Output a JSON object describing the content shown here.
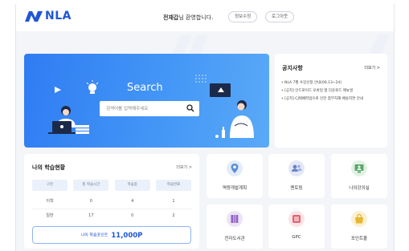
{
  "header": {
    "logo_text": "NLA",
    "welcome_name": "전재갑",
    "welcome_suffix": "님 환영합니다.",
    "buttons": {
      "profile_edit": "정보수정",
      "logout": "로그아웃"
    }
  },
  "banner": {
    "title": "Search",
    "search_placeholder": "검색어를 입력해주세요"
  },
  "notice": {
    "title": "공지사항",
    "more": "더보기 >",
    "items": [
      "• NLA 7월 수강신청 안내(06.13~24)",
      "• [공지] 안드로이드 모바일 앱 다운로드 매뉴얼",
      "• [공지] CJ택배파업으로 인한 참부자재 배송지연 안내"
    ]
  },
  "study": {
    "title": "나의 학습현황",
    "more": "더보기 >",
    "headers": [
      "구분",
      "총 학습시간",
      "학습중",
      "학습완료"
    ],
    "rows": [
      [
        "이학",
        "0",
        "4",
        "1"
      ],
      [
        "일반",
        "17",
        "0",
        "2"
      ]
    ],
    "total_label": "나의 학습포인트",
    "total_value": "11,000P"
  },
  "tiles": [
    {
      "label": "역량개발계획",
      "icon": "location-pin-icon",
      "color": "#5b8fd6",
      "bg": "#e3ecf8"
    },
    {
      "label": "멘토링",
      "icon": "users-icon",
      "color": "#6c83c9",
      "bg": "#e4e8f6"
    },
    {
      "label": "나의강의실",
      "icon": "classroom-icon",
      "color": "#5aa86a",
      "bg": "#e2f1e4"
    },
    {
      "label": "전자도서관",
      "icon": "books-icon",
      "color": "#8f63c2",
      "bg": "#ece3f6"
    },
    {
      "label": "GPC",
      "icon": "list-icon",
      "color": "#e0656f",
      "bg": "#fbe4e6"
    },
    {
      "label": "포인트몰",
      "icon": "shopping-bag-icon",
      "color": "#e8b530",
      "bg": "#fbf0d2"
    }
  ],
  "colors": {
    "brand": "#1f56d6",
    "banner": "#3a8af5"
  }
}
